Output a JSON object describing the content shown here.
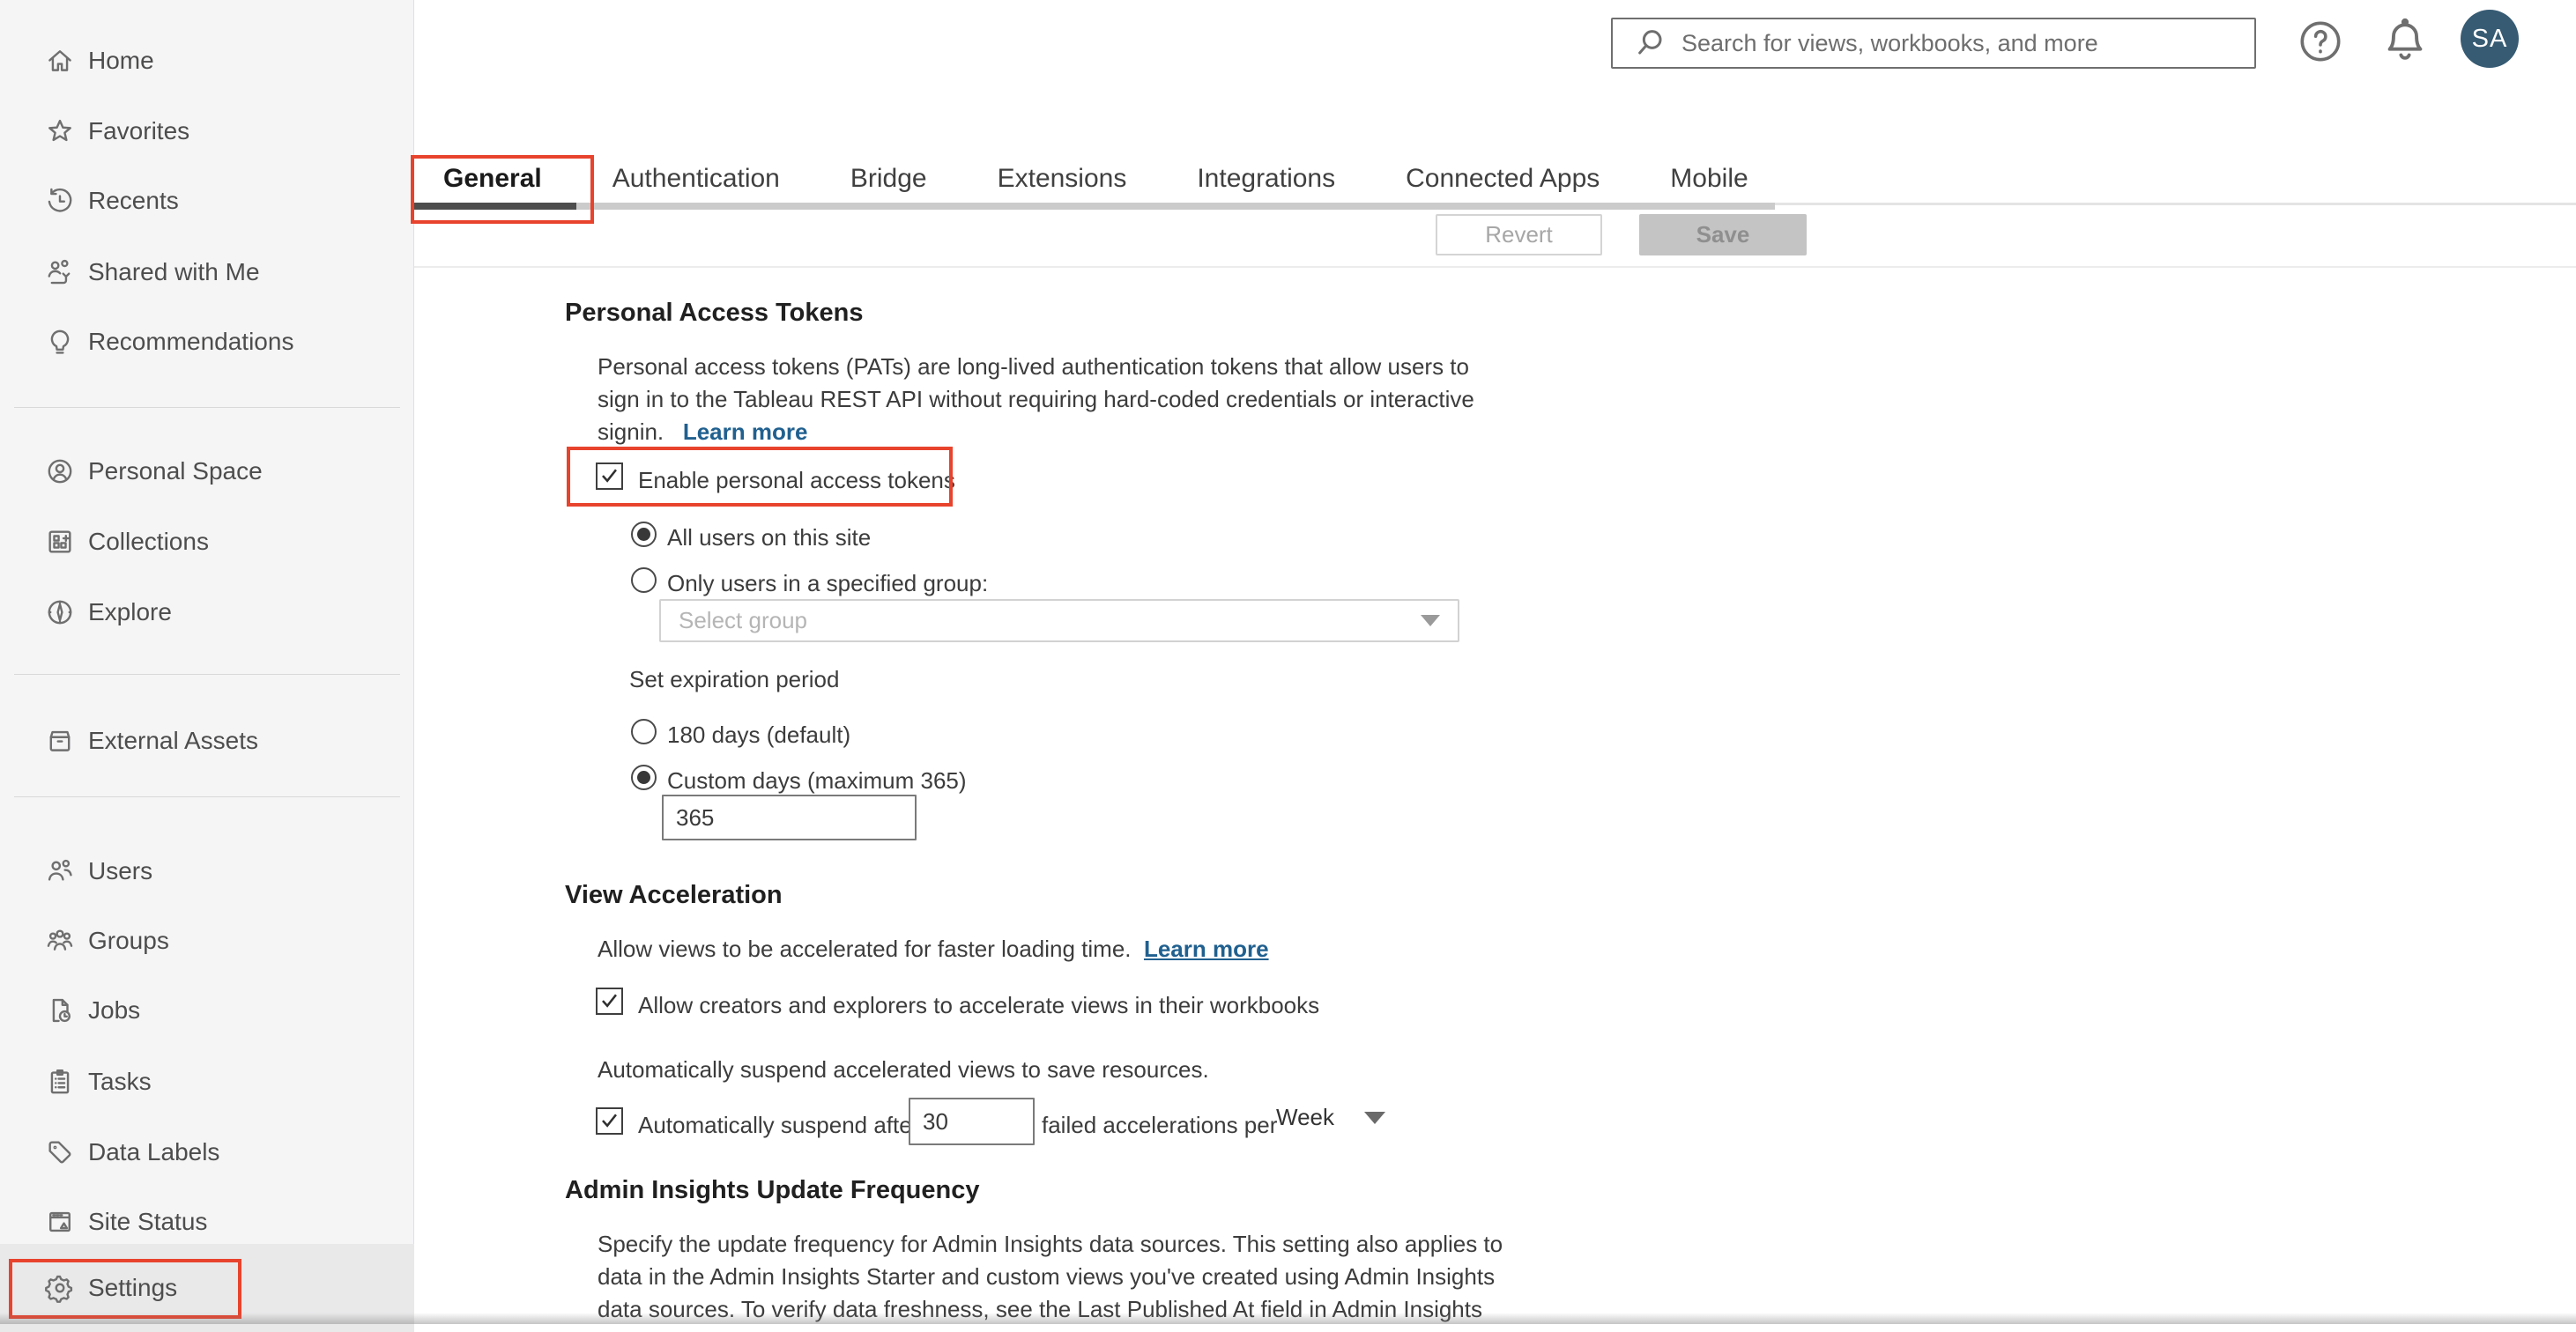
{
  "colors": {
    "callout_red": "#e8432d",
    "link_blue": "#20608f",
    "avatar_bg": "#365b73",
    "active_tab_underline": "#4d4d4d",
    "sidebar_bg": "#f5f5f6"
  },
  "header": {
    "search_placeholder": "Search for views, workbooks, and more",
    "help_icon": "question-circle",
    "notifications_icon": "bell",
    "avatar_initials": "SA"
  },
  "sidebar": {
    "items": [
      {
        "label": "Home",
        "icon": "home"
      },
      {
        "label": "Favorites",
        "icon": "star"
      },
      {
        "label": "Recents",
        "icon": "history-clock"
      },
      {
        "label": "Shared with Me",
        "icon": "shared-users"
      },
      {
        "label": "Recommendations",
        "icon": "lightbulb"
      },
      {
        "label": "Personal Space",
        "icon": "person-circle"
      },
      {
        "label": "Collections",
        "icon": "collection-grid"
      },
      {
        "label": "Explore",
        "icon": "compass"
      },
      {
        "label": "External Assets",
        "icon": "asset-box"
      },
      {
        "label": "Users",
        "icon": "users"
      },
      {
        "label": "Groups",
        "icon": "groups"
      },
      {
        "label": "Jobs",
        "icon": "page-clock"
      },
      {
        "label": "Tasks",
        "icon": "clipboard-list"
      },
      {
        "label": "Data Labels",
        "icon": "tag"
      },
      {
        "label": "Site Status",
        "icon": "window-status"
      },
      {
        "label": "Settings",
        "icon": "gear"
      }
    ]
  },
  "tabs": {
    "active": "General",
    "items": [
      {
        "label": "General"
      },
      {
        "label": "Authentication"
      },
      {
        "label": "Bridge"
      },
      {
        "label": "Extensions"
      },
      {
        "label": "Integrations"
      },
      {
        "label": "Connected Apps"
      },
      {
        "label": "Mobile"
      }
    ]
  },
  "toolbar": {
    "revert_label": "Revert",
    "save_label": "Save"
  },
  "sections": {
    "pat": {
      "title": "Personal Access Tokens",
      "desc_line1": "Personal access tokens (PATs) are long-lived authentication tokens that allow users to",
      "desc_line2": "sign in to the Tableau REST API without requiring hard-coded credentials or interactive",
      "desc_line3": "signin.",
      "learn_more": "Learn more",
      "enable_checkbox_label": "Enable personal access tokens",
      "enable_checkbox_checked": true,
      "radio_all_users": "All users on this site",
      "radio_all_users_selected": true,
      "radio_specified_group": "Only users in a specified group:",
      "radio_specified_group_selected": false,
      "group_select_placeholder": "Select group",
      "expiration_label": "Set expiration period",
      "radio_180_days": "180 days (default)",
      "radio_180_days_selected": false,
      "radio_custom_days": "Custom days (maximum 365)",
      "radio_custom_days_selected": true,
      "custom_days_value": "365"
    },
    "view_acceleration": {
      "title": "View Acceleration",
      "description": "Allow views to be accelerated for faster loading time.",
      "learn_more": "Learn more",
      "allow_checkbox_label": "Allow creators and explorers to accelerate views in their workbooks",
      "allow_checkbox_checked": true,
      "suspend_description": "Automatically suspend accelerated views to save resources.",
      "suspend_checkbox_prefix": "Automatically suspend after",
      "suspend_checkbox_checked": true,
      "suspend_count_value": "30",
      "suspend_checkbox_suffix": "failed accelerations per",
      "period_value": "Week"
    },
    "admin_insights": {
      "title": "Admin Insights Update Frequency",
      "desc_line1": "Specify the update frequency for Admin Insights data sources. This setting also applies to",
      "desc_line2": "data in the Admin Insights Starter and custom views you've created using Admin Insights",
      "desc_line3": "data sources. To verify data freshness, see the Last Published At field in Admin Insights"
    }
  }
}
